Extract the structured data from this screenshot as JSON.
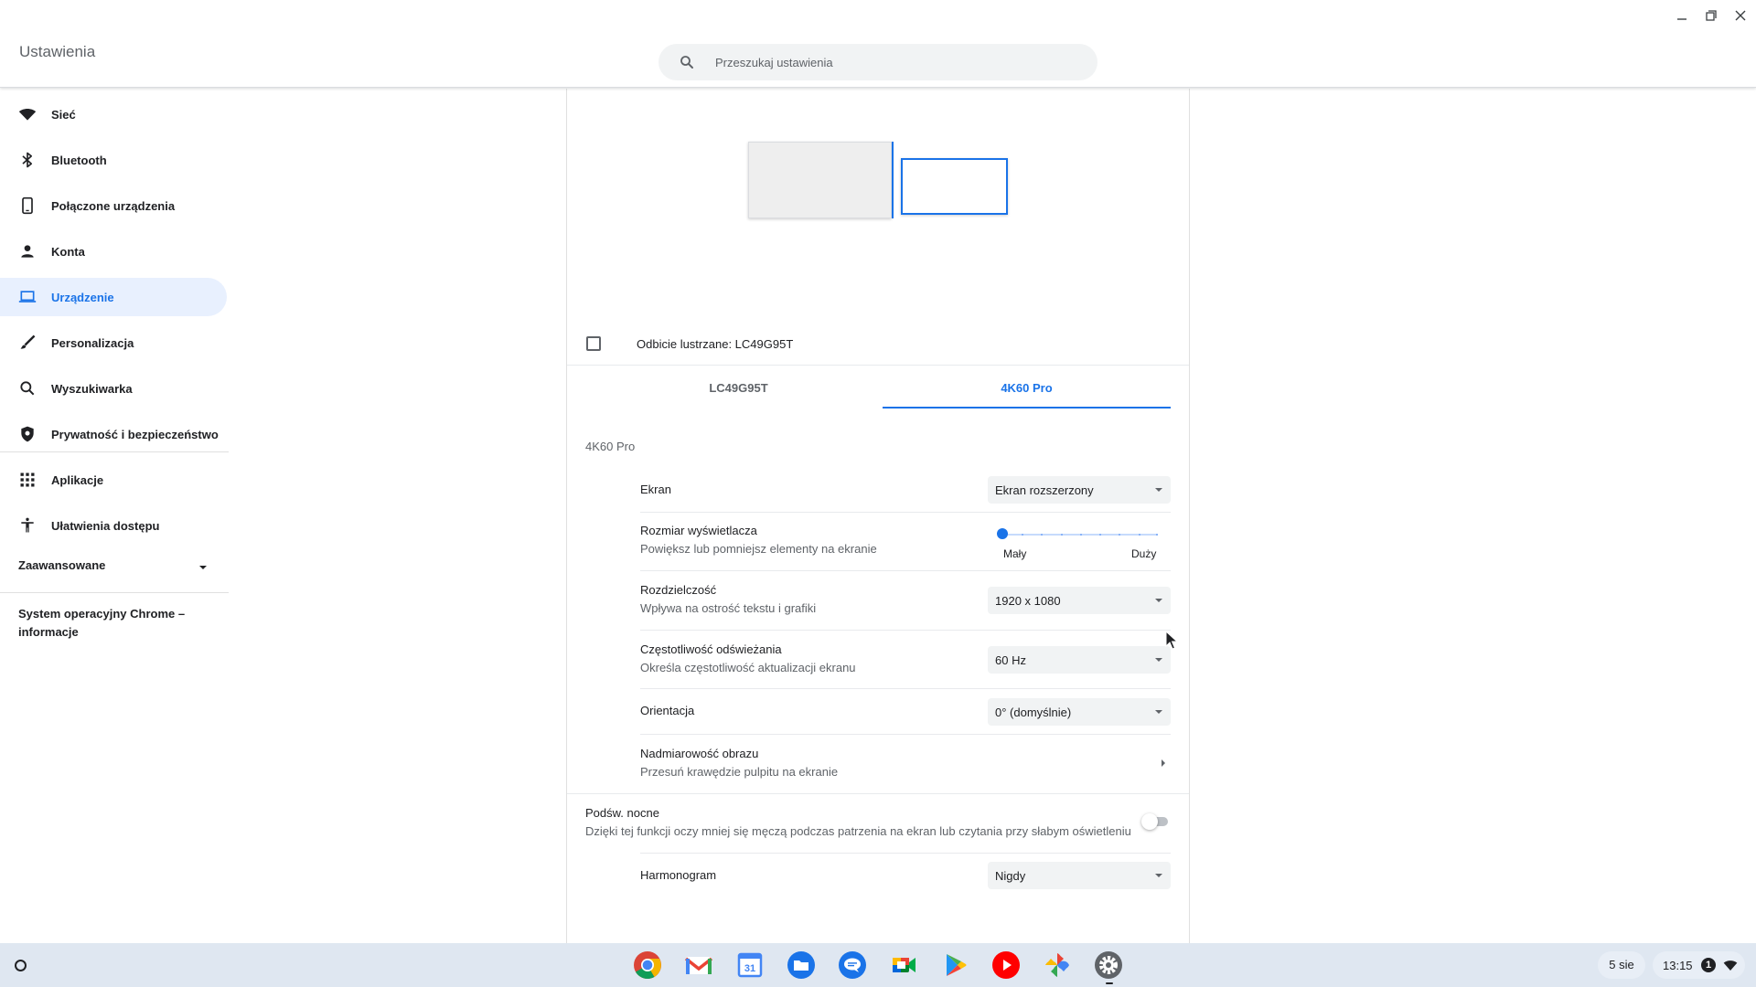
{
  "app": {
    "title": "Ustawienia"
  },
  "search": {
    "placeholder": "Przeszukaj ustawienia",
    "value": ""
  },
  "sidebar": {
    "items": [
      {
        "label": "Sieć",
        "icon": "wifi-icon"
      },
      {
        "label": "Bluetooth",
        "icon": "bluetooth-icon"
      },
      {
        "label": "Połączone urządzenia",
        "icon": "phone-icon"
      },
      {
        "label": "Konta",
        "icon": "person-icon"
      },
      {
        "label": "Urządzenie",
        "icon": "laptop-icon",
        "active": true
      },
      {
        "label": "Personalizacja",
        "icon": "brush-icon"
      },
      {
        "label": "Wyszukiwarka",
        "icon": "search-icon"
      },
      {
        "label": "Prywatność i bezpieczeństwo",
        "icon": "shield-icon"
      },
      {
        "label": "Aplikacje",
        "icon": "apps-grid-icon"
      },
      {
        "label": "Ułatwienia dostępu",
        "icon": "accessibility-icon"
      }
    ],
    "advanced": "Zaawansowane",
    "about": "System operacyjny Chrome – informacje"
  },
  "display": {
    "mirror_label": "Odbicie lustrzane: LC49G95T",
    "tabs": [
      "LC49G95T",
      "4K60 Pro"
    ],
    "active_tab": 1,
    "section_title": "4K60 Pro",
    "screen": {
      "label": "Ekran",
      "value": "Ekran rozszerzony"
    },
    "size": {
      "label": "Rozmiar wyświetlacza",
      "sub": "Powiększ lub pomniejsz elementy na ekranie",
      "min_label": "Mały",
      "max_label": "Duży",
      "level": 0
    },
    "resolution": {
      "label": "Rozdzielczość",
      "sub": "Wpływa na ostrość tekstu i grafiki",
      "value": "1920 x 1080"
    },
    "refresh": {
      "label": "Częstotliwość odświeżania",
      "sub": "Określa częstotliwość aktualizacji ekranu",
      "value": "60 Hz"
    },
    "orientation": {
      "label": "Orientacja",
      "value": "0° (domyślnie)"
    },
    "overscan": {
      "label": "Nadmiarowość obrazu",
      "sub": "Przesuń krawędzie pulpitu na ekranie"
    },
    "night_light": {
      "label": "Podśw. nocne",
      "sub": "Dzięki tej funkcji oczy mniej się męczą podczas patrzenia na ekran lub czytania przy słabym oświetleniu",
      "enabled": false
    },
    "schedule": {
      "label": "Harmonogram",
      "value": "Nigdy"
    }
  },
  "shelf": {
    "apps": [
      "chrome",
      "gmail",
      "calendar",
      "files",
      "messages",
      "meet",
      "play-store",
      "youtube",
      "photos",
      "settings"
    ],
    "calendar_day": "31",
    "date": "5 sie",
    "time": "13:15",
    "notification_count": "1"
  },
  "colors": {
    "accent": "#1a73e8",
    "active_nav_bg": "#e8f0fe",
    "shelf_bg": "#dfe7f1"
  }
}
